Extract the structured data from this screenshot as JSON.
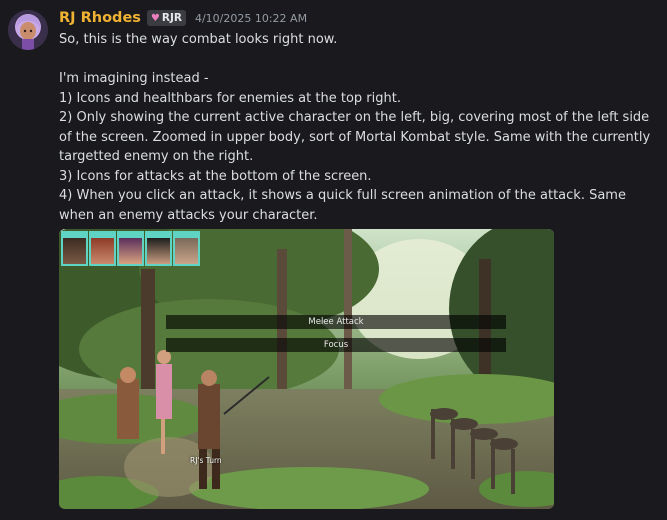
{
  "post": {
    "username": "RJ Rhodes",
    "tag": "RJR",
    "timestamp": "4/10/2025 10:22 AM",
    "lines": [
      "So, this is the way combat looks right now.",
      "",
      "I'm imagining instead -",
      "1) Icons and healthbars for enemies at the top right.",
      "2) Only showing the current active character on the left, big, covering most of the left side of the screen. Zoomed in upper body, sort of Mortal Kombat style. Same with the currently targetted enemy on the right.",
      "3) Icons for attacks at the bottom of the screen.",
      "4) When you click an attack, it shows a quick full screen animation of the attack. Same when an enemy attacks your character."
    ]
  },
  "game": {
    "actions": [
      "Melee Attack",
      "Focus"
    ],
    "turn_label": "RJ's Turn"
  },
  "colors": {
    "username": "#f0b232",
    "background": "#1a1a1e",
    "portrait_frame": "#5fd3c4"
  }
}
